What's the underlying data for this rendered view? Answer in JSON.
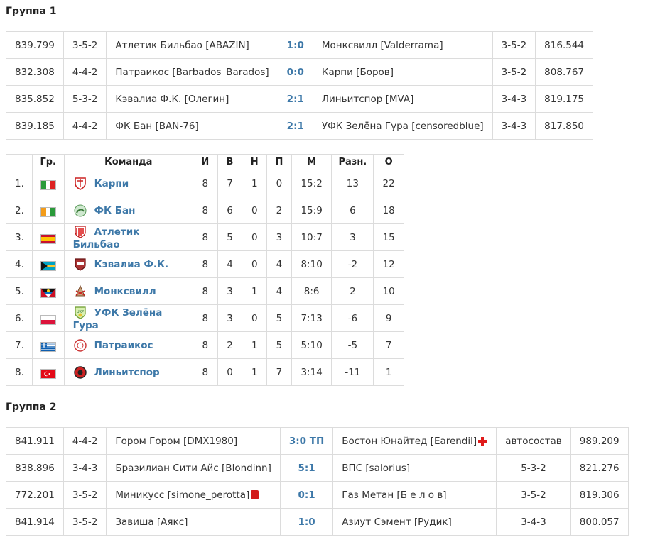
{
  "group1": {
    "title": "Группа 1",
    "matches": [
      {
        "home_rating": "839.799",
        "home_form": "3-5-2",
        "home": "Атлетик Бильбао [ABAZIN]",
        "score": "1:0",
        "away": "Монксвилл [Valderrama]",
        "away_form": "3-5-2",
        "away_rating": "816.544"
      },
      {
        "home_rating": "832.308",
        "home_form": "4-4-2",
        "home": "Патраикос [Barbados_Barados]",
        "score": "0:0",
        "away": "Карпи [Боров]",
        "away_form": "3-5-2",
        "away_rating": "808.767"
      },
      {
        "home_rating": "835.852",
        "home_form": "5-3-2",
        "home": "Кэвалиа Ф.К. [Олегин]",
        "score": "2:1",
        "away": "Линьитспор [MVA]",
        "away_form": "3-4-3",
        "away_rating": "819.175"
      },
      {
        "home_rating": "839.185",
        "home_form": "4-4-2",
        "home": "ФК Бан [BAN-76]",
        "score": "2:1",
        "away": "УФК Зелёна Гура [censoredblue]",
        "away_form": "3-4-3",
        "away_rating": "817.850"
      }
    ],
    "standings": {
      "headers": [
        "Гр.",
        "Команда",
        "И",
        "В",
        "Н",
        "П",
        "М",
        "Разн.",
        "О"
      ],
      "rows": [
        {
          "pos": "1.",
          "flag": "italy-flag",
          "crest": "carpi-crest",
          "team": "Карпи",
          "p": "8",
          "w": "7",
          "d": "1",
          "l": "0",
          "goals": "15:2",
          "diff": "13",
          "pts": "22"
        },
        {
          "pos": "2.",
          "flag": "ivory-coast-flag",
          "crest": "fk-ban-crest",
          "team": "ФК Бан",
          "p": "8",
          "w": "6",
          "d": "0",
          "l": "2",
          "goals": "15:9",
          "diff": "6",
          "pts": "18"
        },
        {
          "pos": "3.",
          "flag": "spain-flag",
          "crest": "athletic-bilbao-crest",
          "team": "Атлетик Бильбао",
          "p": "8",
          "w": "5",
          "d": "0",
          "l": "3",
          "goals": "10:7",
          "diff": "3",
          "pts": "15"
        },
        {
          "pos": "4.",
          "flag": "bahamas-flag",
          "crest": "kevalia-crest",
          "team": "Кэвалиа Ф.К.",
          "p": "8",
          "w": "4",
          "d": "0",
          "l": "4",
          "goals": "8:10",
          "diff": "-2",
          "pts": "12"
        },
        {
          "pos": "5.",
          "flag": "antigua-flag",
          "crest": "monksville-crest",
          "team": "Монксвилл",
          "p": "8",
          "w": "3",
          "d": "1",
          "l": "4",
          "goals": "8:6",
          "diff": "2",
          "pts": "10"
        },
        {
          "pos": "6.",
          "flag": "poland-flag",
          "crest": "ufk-zielona-gora-crest",
          "team": "УФК Зелёна Гура",
          "p": "8",
          "w": "3",
          "d": "0",
          "l": "5",
          "goals": "7:13",
          "diff": "-6",
          "pts": "9"
        },
        {
          "pos": "7.",
          "flag": "greece-flag",
          "crest": "patraikos-crest",
          "team": "Патраикос",
          "p": "8",
          "w": "2",
          "d": "1",
          "l": "5",
          "goals": "5:10",
          "diff": "-5",
          "pts": "7"
        },
        {
          "pos": "8.",
          "flag": "turkey-flag",
          "crest": "linyitspor-crest",
          "team": "Линьитспор",
          "p": "8",
          "w": "0",
          "d": "1",
          "l": "7",
          "goals": "3:14",
          "diff": "-11",
          "pts": "1"
        }
      ]
    }
  },
  "group2": {
    "title": "Группа 2",
    "matches": [
      {
        "home_rating": "841.911",
        "home_form": "4-4-2",
        "home": "Гором Гором [DMX1980]",
        "score": "3:0 ТП",
        "away": "Бостон Юнайтед [Earendil]",
        "away_form": "автосостав",
        "away_rating": "989.209",
        "away_icon": "red-cross-icon"
      },
      {
        "home_rating": "838.896",
        "home_form": "3-4-3",
        "home": "Бразилиан Сити Айс [Blondinn]",
        "score": "5:1",
        "away": "ВПС [salorius]",
        "away_form": "5-3-2",
        "away_rating": "821.276"
      },
      {
        "home_rating": "772.201",
        "home_form": "3-5-2",
        "home": "Миникусс [simone_perotta]",
        "home_icon": "red-card-icon",
        "score": "0:1",
        "away": "Газ Метан [Б е л о в]",
        "away_form": "3-5-2",
        "away_rating": "819.306"
      },
      {
        "home_rating": "841.914",
        "home_form": "3-5-2",
        "home": "Завиша [Аякс]",
        "score": "1:0",
        "away": "Азиут Сэмент [Рудик]",
        "away_form": "3-4-3",
        "away_rating": "800.057"
      }
    ]
  }
}
